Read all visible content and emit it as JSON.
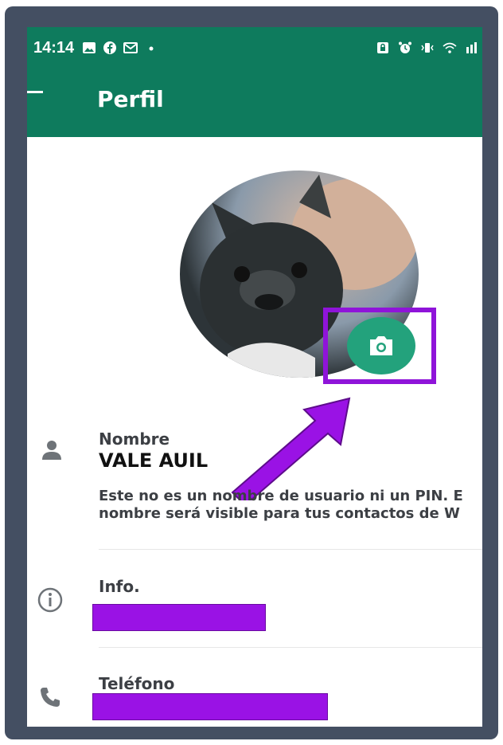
{
  "status_bar": {
    "time": "14:14",
    "left_icons": [
      "image-icon",
      "facebook-icon",
      "gmail-icon",
      "dot-icon"
    ],
    "right_icons": [
      "lock-icon",
      "alarm-icon",
      "vibrate-icon",
      "wifi-icon",
      "lte-icon"
    ]
  },
  "app_bar": {
    "title": "Perfil",
    "color": "#0e7b5d"
  },
  "profile": {
    "photo_alt": "profile-photo",
    "camera_button_color": "#23a27c",
    "highlight_color": "#8f14d9"
  },
  "fields": {
    "name": {
      "label": "Nombre",
      "value": "VALE AUIL",
      "description_line1": "Este no es un nombre de usuario ni un PIN. E",
      "description_line2": "nombre será visible para tus contactos de W"
    },
    "info": {
      "label": "Info.",
      "value_redacted": true
    },
    "phone": {
      "label": "Teléfono",
      "value_redacted": true
    }
  }
}
